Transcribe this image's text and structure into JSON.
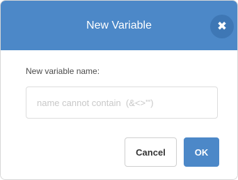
{
  "dialog": {
    "title": "New Variable",
    "close_icon": "close-icon"
  },
  "form": {
    "label": "New variable name:",
    "input_value": "",
    "input_placeholder": "name cannot contain  (&<>'\")"
  },
  "actions": {
    "cancel_label": "Cancel",
    "ok_label": "OK"
  },
  "colors": {
    "header": "#4c88c8",
    "close_button": "#3e77b5",
    "ok_button": "#4c88c8"
  }
}
